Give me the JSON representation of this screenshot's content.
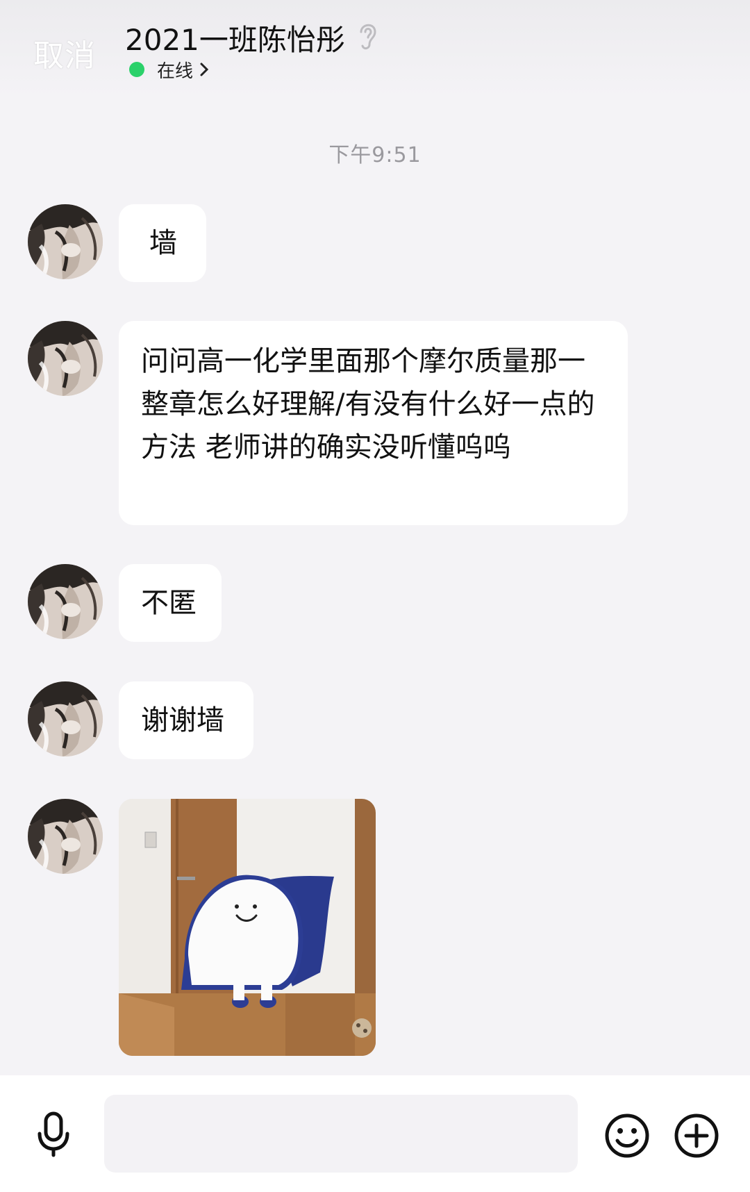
{
  "header": {
    "cancel_label": "取消",
    "title": "2021一班陈怡彤",
    "title_icon": "ear-icon",
    "status": "在线",
    "status_color": "#2bd16a",
    "status_chevron_icon": "chevron-right-icon"
  },
  "chat": {
    "timestamp": "下午9:51",
    "messages": [
      {
        "type": "text",
        "avatar_icon": "avatar",
        "text": "墙"
      },
      {
        "type": "text",
        "avatar_icon": "avatar",
        "text": "问问高一化学里面那个摩尔质量那一整章怎么好理解/有没有什么好一点的方法 老师讲的确实没听懂呜呜"
      },
      {
        "type": "text",
        "avatar_icon": "avatar",
        "text": "不匿"
      },
      {
        "type": "text",
        "avatar_icon": "avatar",
        "text": "谢谢墙"
      },
      {
        "type": "image",
        "avatar_icon": "avatar",
        "image_description_icon": "sticker-image"
      }
    ]
  },
  "input_bar": {
    "voice_icon": "microphone-icon",
    "input_value": "",
    "input_placeholder": "",
    "emoji_icon": "emoji-icon",
    "more_icon": "plus-circle-icon"
  },
  "colors": {
    "background": "#f4f3f6",
    "bubble": "#ffffff",
    "timestamp": "#9a999e"
  }
}
